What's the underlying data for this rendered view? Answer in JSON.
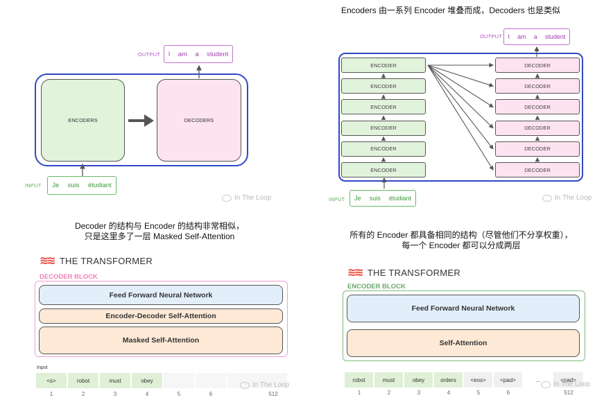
{
  "panel_tl": {
    "output_label": "OUTPUT",
    "output_words": [
      "I",
      "am",
      "a",
      "student"
    ],
    "encoders_label": "ENCODERS",
    "decoders_label": "DECODERS",
    "input_label": "INPUT",
    "input_words": [
      "Je",
      "suis",
      "étudiant"
    ],
    "watermark": "In The Loop"
  },
  "panel_tr": {
    "caption": "Encoders 由一系列 Encoder 堆叠而成，Decoders 也是类似",
    "output_label": "OUTPUT",
    "output_words": [
      "I",
      "am",
      "a",
      "student"
    ],
    "encoder_label": "ENCODER",
    "decoder_label": "DECODER",
    "stack_count": 6,
    "input_label": "INPUT",
    "input_words": [
      "Je",
      "suis",
      "étudiant"
    ],
    "watermark": "In The Loop"
  },
  "panel_bl": {
    "caption_line1": "Decoder 的结构与 Encoder 的结构非常相似，",
    "caption_line2": "只是这里多了一层 Masked Self-Attention",
    "title": "THE TRANSFORMER",
    "block_label": "DECODER BLOCK",
    "layers": [
      "Feed Forward Neural Network",
      "Encoder-Decoder Self-Attention",
      "Masked Self-Attention"
    ],
    "input_label": "Input",
    "tokens": [
      "<s>",
      "robot",
      "must",
      "obey",
      "",
      "",
      ""
    ],
    "indices": [
      "1",
      "2",
      "3",
      "4",
      "5",
      "6",
      "512"
    ],
    "watermark": "In The Loop"
  },
  "panel_br": {
    "caption_line1": "所有的 Encoder 都具备相同的结构（尽管他们不分享权重），",
    "caption_line2": "每一个 Encoder 都可以分成两层",
    "title": "THE TRANSFORMER",
    "block_label": "ENCODER BLOCK",
    "layers": [
      "Feed Forward Neural Network",
      "Self-Attention"
    ],
    "tokens": [
      "robot",
      "must",
      "obey",
      "orders",
      "<eos>",
      "<pad>",
      "...",
      "<pad>"
    ],
    "indices": [
      "1",
      "2",
      "3",
      "4",
      "5",
      "6",
      "",
      "512"
    ],
    "watermark": "In The Loop"
  },
  "colors": {
    "encoder_fill": "#e2f3dc",
    "decoder_fill": "#fde3ef",
    "blue_border": "#2f47c7",
    "output_purple": "#b050c0",
    "input_green": "#55b055",
    "ffnn_fill": "#e3eefb",
    "attn_fill": "#fde9d6",
    "token_green": "#dff0d6",
    "decoder_block_pink": "#f090c0",
    "encoder_block_green": "#7cba7c"
  }
}
